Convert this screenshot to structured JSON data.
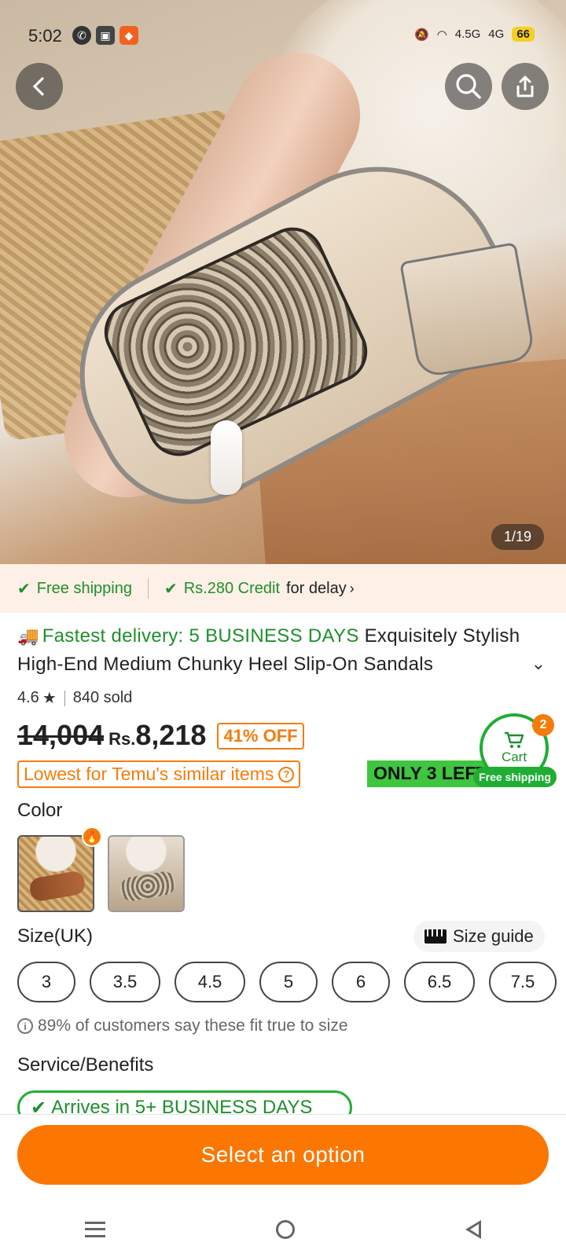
{
  "status_bar": {
    "time": "5:02",
    "network_1": "4.5G",
    "network_2": "4G",
    "battery": "66"
  },
  "gallery": {
    "counter": "1/19"
  },
  "shipping_strip": {
    "free_shipping": "Free shipping",
    "credit": "Rs.280 Credit",
    "credit_suffix": "for delay"
  },
  "product": {
    "fast_prefix": "Fastest delivery: 5 BUSINESS DAYS",
    "title": "Exquisitely Stylish High-End Medium Chunky Heel Slip-On Sandals",
    "rating": "4.6",
    "sold": "840 sold",
    "old_price": "14,004",
    "currency": "Rs.",
    "price": "8,218",
    "discount": "41% OFF",
    "lowest_label": "Lowest for Temu's similar items",
    "stock_label": "ONLY 3 LEFT"
  },
  "cart": {
    "label": "Cart",
    "count": "2",
    "free_shipping": "Free shipping"
  },
  "color": {
    "label": "Color",
    "options": [
      "Brown",
      "Snake Print"
    ]
  },
  "size": {
    "label": "Size(UK)",
    "guide": "Size guide",
    "options": [
      "3",
      "3.5",
      "4.5",
      "5",
      "6",
      "6.5",
      "7.5"
    ],
    "fit_note": "89% of customers say these fit true to size"
  },
  "service": {
    "label": "Service/Benefits",
    "arrives": "Arrives in 5+ BUSINESS DAYS"
  },
  "cta": {
    "label": "Select an option"
  },
  "colors": {
    "accent": "#fb7701",
    "green": "#1fae33",
    "stock_green": "#3ec63e"
  }
}
